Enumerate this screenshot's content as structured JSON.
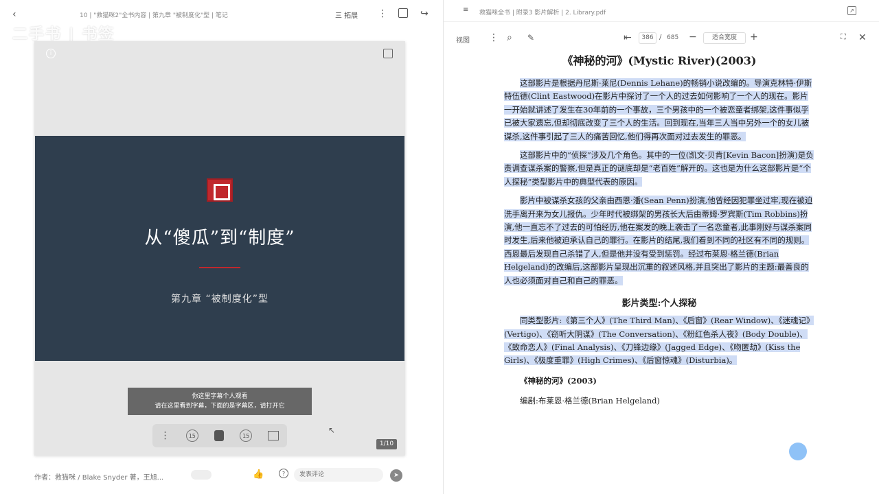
{
  "left_panel": {
    "topbar": {
      "breadcrumb": "10 | \"救猫咪2\"全书内容 | 第九章 \"被制度化\"型 | 笔记",
      "action_label": "三 拓展",
      "more": "⋮"
    },
    "watermark": "二手书 | 书签",
    "slide": {
      "title": "从“傻瓜”到“制度”",
      "subtitle": "第九章 “被制度化”型"
    },
    "caption": {
      "line1": "你这里字幕个人观看",
      "line2": "请在这里看到字幕，下面的是字幕区，请打开它"
    },
    "page_indicator": "1/10",
    "bottom": {
      "author": "作者：救猫咪 / Blake Snyder 著，王旭...",
      "input_placeholder": "发表评论"
    }
  },
  "right_panel": {
    "file_path": "救猫咪全书 | 附录3 影片解析 | 2. Library.pdf",
    "toolbar": {
      "view_label": "视图",
      "page_current": "386",
      "page_total": "685",
      "zoom": "适合宽度"
    },
    "document": {
      "title": "《神秘的河》(Mystic River)(2003)",
      "paragraphs": [
        "这部影片是根据丹尼斯·莱尼(Dennis Lehane)的畅销小说改编的。导演克林特·伊斯特伍德(Clint Eastwood)在影片中探讨了一个人的过去如何影响了一个人的现在。影片一开始就讲述了发生在30年前的一个事故，三个男孩中的一个被恋童者绑架,这件事似乎已被大家遗忘,但却彻底改变了三个人的生活。回到现在,当年三人当中另外一个的女儿被谋杀,这件事引起了三人的痛苦回忆,他们得再次面对过去发生的罪恶。",
        "这部影片中的“侦探”涉及几个角色。其中的一位(凯文·贝肯[Kevin Bacon]扮演)是负责调查谋杀案的警察,但是真正的谜底却是“老百姓”解开的。这也是为什么这部影片是“个人探秘”类型影片中的典型代表的原因。",
        "影片中被谋杀女孩的父亲由西恩·潘(Sean Penn)扮演,他曾经因犯罪坐过牢,现在被迫洗手离开来为女儿报仇。少年时代被绑架的男孩长大后由蒂姆·罗宾斯(Tim Robbins)扮演,他一直忘不了过去的可怕经历,他在案发的晚上袭击了一名恋童者,此事刚好与谋杀案同时发生,后来他被迫承认自己的罪行。在影片的结尾,我们看到不同的社区有不同的规则。西恩最后发现自己杀错了人,但是他并没有受到惩罚。经过布莱恩·格兰德(Brian Helgeland)的改编后,这部影片呈现出沉重的叙述风格,并且突出了影片的主题:最善良的人也必须面对自己和自己的罪恶。"
      ],
      "section_heading": "影片类型:个人探秘",
      "same_type": "同类型影片:《第三个人》(The Third Man)、《后窗》(Rear Window)、《迷魂记》(Vertigo)、《窃听大阴谋》(The Conversation)、《粉红色杀人夜》(Body Double)、《致命恋人》(Final Analysis)、《刀锋边缘》(Jagged Edge)、《吻匿劫》(Kiss the Girls)、《极度重罪》(High Crimes)、《后窗惊魂》(Disturbia)。",
      "film_line": "《神秘的河》(2003)",
      "writer_line": "编剧:布莱恩·格兰德(Brian Helgeland)"
    }
  }
}
